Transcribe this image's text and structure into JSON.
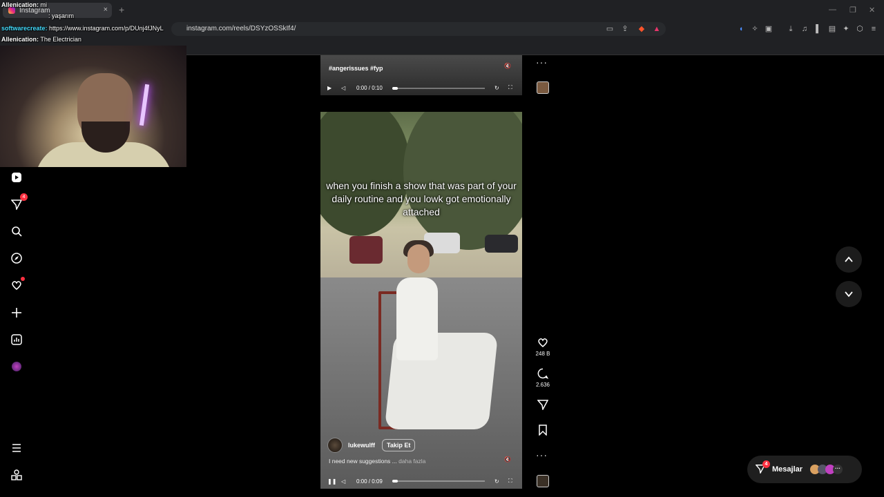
{
  "browser": {
    "tab_title": "Instagram",
    "url": "instagram.com/reels/DSYzOSSkIf4/"
  },
  "chat": {
    "line1_user": "Allenication:",
    "line1_text": "mi",
    "line2_text": ": yaşarım",
    "line3_user": "softwarecreate:",
    "line3_text": "https://www.instagram.com/p/DUnj4fJNyL",
    "line4_user": "Allenication:",
    "line4_text": "The Electrician",
    "line5_text": "YouTube"
  },
  "nav": {
    "messages_badge": "4"
  },
  "reel_top": {
    "hashtags": "#angerissues #fyp",
    "time": "0:00 / 0:10"
  },
  "reel_main": {
    "caption": "when you finish a show that was part of your daily routine and you lowk got emotionally attached",
    "username": "lukewulff",
    "follow_label": "Takip Et",
    "description": "I need new suggestions ...",
    "more_label": "daha fazla",
    "time": "0:00 / 0:09"
  },
  "actions": {
    "likes": "248 B",
    "comments": "2.636"
  },
  "messages": {
    "label": "Mesajlar",
    "badge": "4"
  },
  "colors": {
    "notification": "#ff3040",
    "chair": "#7a2a22"
  }
}
